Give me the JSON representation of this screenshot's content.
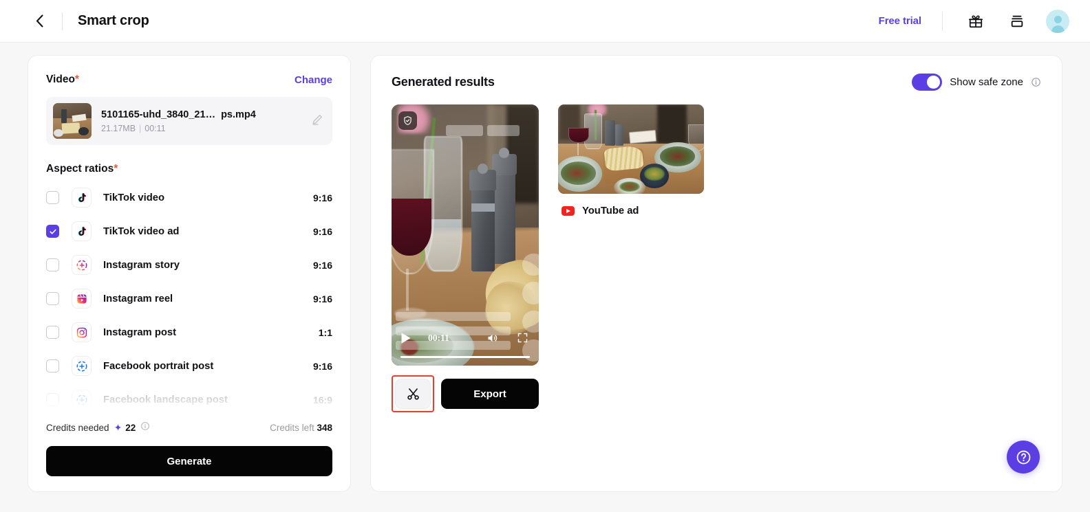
{
  "header": {
    "back_icon": "chevron-left-icon",
    "title": "Smart crop",
    "free_trial": "Free trial",
    "gift_icon": "gift-icon",
    "layers_icon": "layers-icon",
    "avatar_icon": "user-avatar"
  },
  "left_panel": {
    "video_section": {
      "label": "Video",
      "required_mark": "*",
      "change_label": "Change",
      "file_name_main": "5101165-uhd_3840_21…",
      "file_name_suffix": "ps.mp4",
      "size": "21.17MB",
      "separator": "|",
      "duration": "00:11",
      "edit_icon": "pencil-edit-icon"
    },
    "ratios_section": {
      "label": "Aspect ratios",
      "required_mark": "*",
      "items": [
        {
          "name": "TikTok video",
          "ratio": "9:16",
          "checked": false,
          "icon": "tiktok-icon"
        },
        {
          "name": "TikTok video ad",
          "ratio": "9:16",
          "checked": true,
          "icon": "tiktok-icon"
        },
        {
          "name": "Instagram story",
          "ratio": "9:16",
          "checked": false,
          "icon": "instagram-story-icon"
        },
        {
          "name": "Instagram reel",
          "ratio": "9:16",
          "checked": false,
          "icon": "instagram-reel-icon"
        },
        {
          "name": "Instagram post",
          "ratio": "1:1",
          "checked": false,
          "icon": "instagram-post-icon"
        },
        {
          "name": "Facebook portrait post",
          "ratio": "9:16",
          "checked": false,
          "icon": "facebook-icon"
        },
        {
          "name": "Facebook landscape post",
          "ratio": "16:9",
          "checked": false,
          "icon": "facebook-icon"
        }
      ]
    },
    "credits": {
      "needed_label": "Credits needed",
      "spark_icon": "sparkle-icon",
      "needed_value": "22",
      "info_icon": "info-circle-icon",
      "left_label": "Credits left",
      "left_value": "348"
    },
    "generate_label": "Generate"
  },
  "right_panel": {
    "title": "Generated results",
    "safe_zone": {
      "label": "Show safe zone",
      "enabled": true,
      "info_icon": "info-circle-icon"
    },
    "player": {
      "shield_icon": "shield-check-icon",
      "play_icon": "play-icon",
      "time": "00:11",
      "volume_icon": "volume-icon",
      "fullscreen_icon": "fullscreen-icon",
      "progress_percent": "100"
    },
    "actions": {
      "crop_icon": "scissors-icon",
      "export_label": "Export"
    },
    "results": [
      {
        "label": "YouTube ad",
        "icon": "youtube-icon"
      }
    ],
    "help_icon": "help-circle-icon"
  },
  "colors": {
    "accent": "#5b3fe4",
    "highlight": "#f03c26",
    "dark": "#050505"
  }
}
